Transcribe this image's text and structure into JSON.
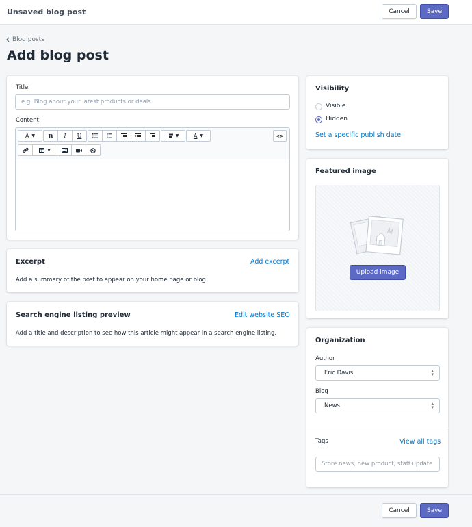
{
  "topbar": {
    "title": "Unsaved blog post",
    "cancel_label": "Cancel",
    "save_label": "Save"
  },
  "breadcrumb": {
    "label": "Blog posts"
  },
  "page": {
    "title": "Add blog post"
  },
  "post": {
    "title_label": "Title",
    "title_placeholder": "e.g. Blog about your latest products or deals",
    "content_label": "Content",
    "toolbar": {
      "font_button": "A",
      "bold": "B",
      "italic": "I",
      "underline": "U",
      "text_color": "A",
      "html_toggle": "<>"
    }
  },
  "excerpt": {
    "heading": "Excerpt",
    "action": "Add excerpt",
    "description": "Add a summary of the post to appear on your home page or blog."
  },
  "seo": {
    "heading": "Search engine listing preview",
    "action": "Edit website SEO",
    "description": "Add a title and description to see how this article might appear in a search engine listing."
  },
  "visibility": {
    "heading": "Visibility",
    "options": [
      {
        "label": "Visible",
        "selected": false
      },
      {
        "label": "Hidden",
        "selected": true
      }
    ],
    "publish_date_link": "Set a specific publish date"
  },
  "featured_image": {
    "heading": "Featured image",
    "upload_label": "Upload image"
  },
  "organization": {
    "heading": "Organization",
    "author_label": "Author",
    "author_value": "Eric Davis",
    "blog_label": "Blog",
    "blog_value": "News",
    "tags_label": "Tags",
    "tags_link": "View all tags",
    "tags_placeholder": "Store news, new product, staff update"
  },
  "footer": {
    "cancel_label": "Cancel",
    "save_label": "Save"
  },
  "colors": {
    "primary": "#5c6ac4",
    "link": "#007ace",
    "background": "#f4f6f8",
    "text": "#212b36"
  }
}
